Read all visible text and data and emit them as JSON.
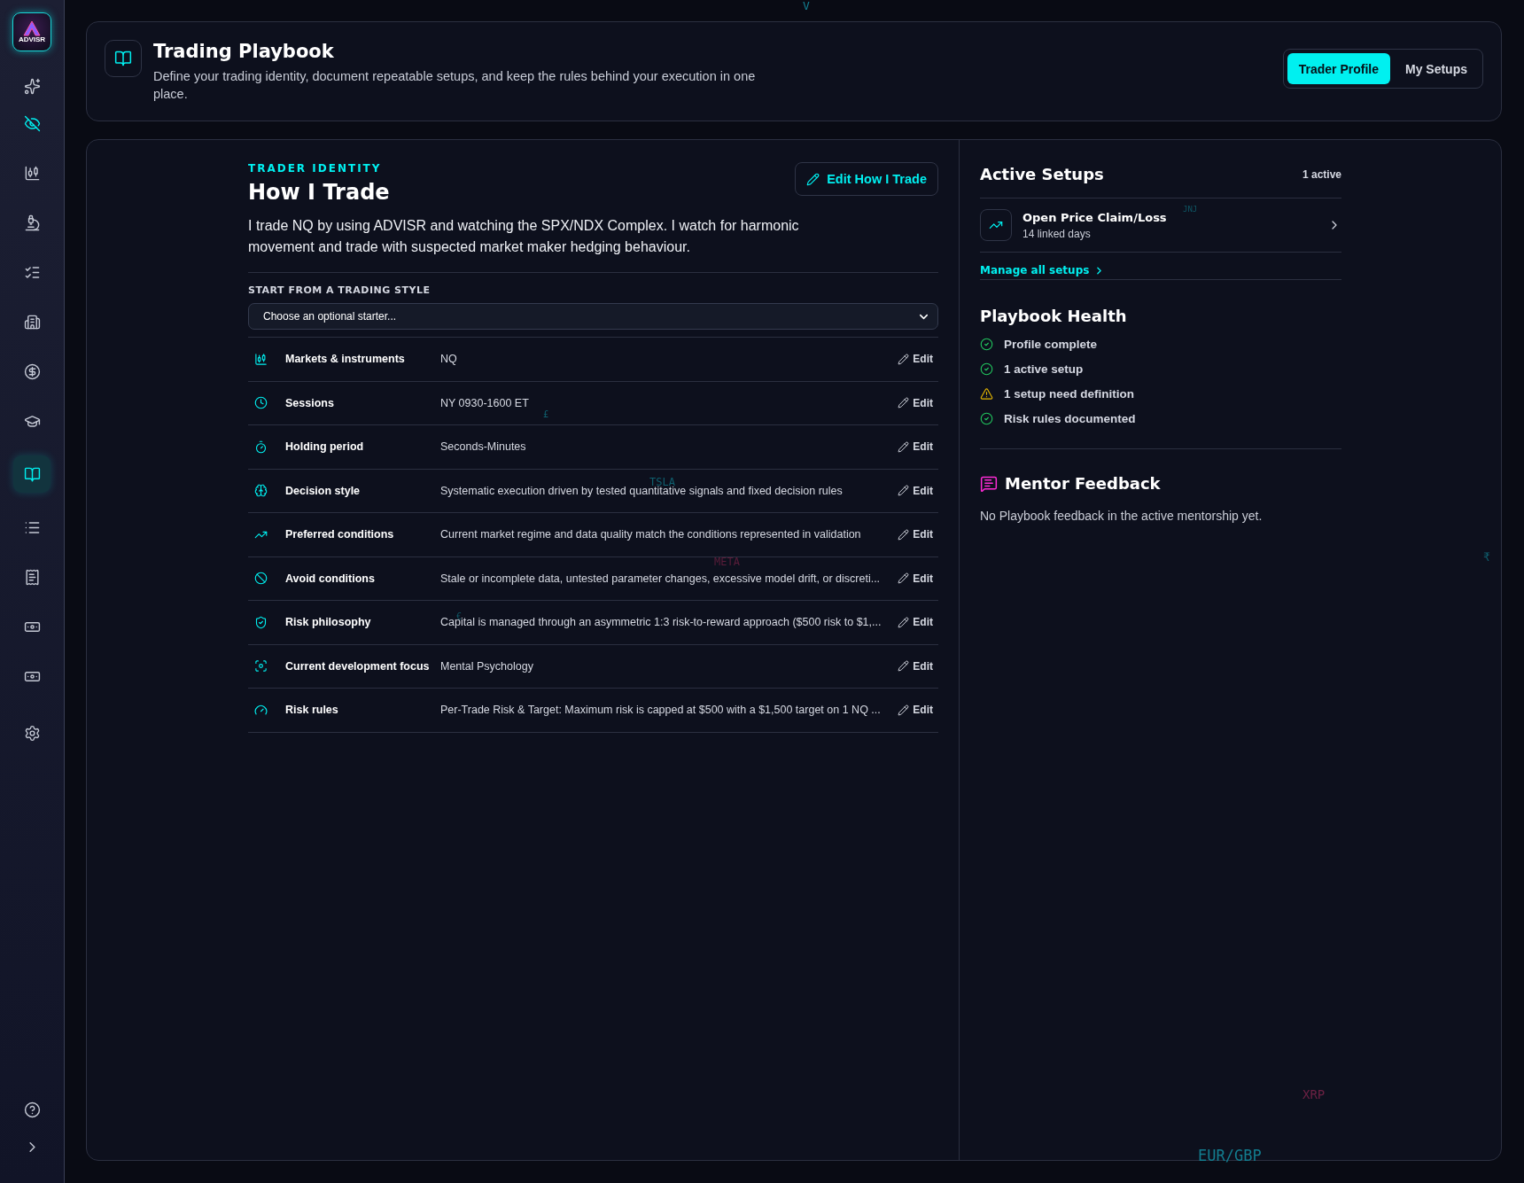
{
  "sidebar": {
    "logo_text": "ADVISR",
    "privacy_toggle": {
      "on": true
    },
    "items": [
      {
        "selected": false
      },
      {
        "selected": false
      },
      {
        "selected": false
      },
      {
        "selected": false
      },
      {
        "selected": false
      },
      {
        "selected": false
      },
      {
        "selected": false
      },
      {
        "selected": true
      },
      {
        "selected": false
      },
      {
        "selected": false
      },
      {
        "selected": false
      },
      {
        "selected": false
      },
      {
        "selected": false
      }
    ]
  },
  "header": {
    "title": "Trading Playbook",
    "subtitle": "Define your trading identity, document repeatable setups, and keep the rules behind your execution in one place.",
    "tabs": [
      {
        "label": "Trader Profile",
        "selected": true
      },
      {
        "label": "My Setups",
        "selected": false
      }
    ]
  },
  "identity": {
    "eyebrow": "TRADER IDENTITY",
    "title": "How I Trade",
    "edit_button": "Edit How I Trade",
    "description": "I trade NQ by using ADVISR and watching the SPX/NDX Complex. I watch for harmonic movement and trade with suspected market maker hedging behaviour.",
    "starter": {
      "label": "START FROM A TRADING STYLE",
      "placeholder": "Choose an optional starter..."
    },
    "rows": [
      {
        "label": "Markets & instruments",
        "value": "NQ",
        "action": "Edit"
      },
      {
        "label": "Sessions",
        "value": "NY 0930-1600 ET",
        "action": "Edit"
      },
      {
        "label": "Holding period",
        "value": "Seconds-Minutes",
        "action": "Edit"
      },
      {
        "label": "Decision style",
        "value": "Systematic execution driven by tested quantitative signals and fixed decision rules",
        "action": "Edit"
      },
      {
        "label": "Preferred conditions",
        "value": "Current market regime and data quality match the conditions represented in validation",
        "action": "Edit"
      },
      {
        "label": "Avoid conditions",
        "value": "Stale or incomplete data, untested parameter changes, excessive model drift, or discreti...",
        "action": "Edit"
      },
      {
        "label": "Risk philosophy",
        "value": "Capital is managed through an asymmetric 1:3 risk-to-reward approach ($500 risk to $1,...",
        "action": "Edit"
      },
      {
        "label": "Current development focus",
        "value": "Mental Psychology",
        "action": "Edit"
      },
      {
        "label": "Risk rules",
        "value": "Per-Trade Risk & Target: Maximum risk is capped at $500 with a $1,500 target on 1 NQ ...",
        "action": "Edit"
      }
    ]
  },
  "active_setups": {
    "title": "Active Setups",
    "count": "1 active",
    "setups": [
      {
        "name": "Open Price Claim/Loss",
        "meta": "14 linked days"
      }
    ],
    "manage_link": "Manage all setups"
  },
  "health": {
    "title": "Playbook Health",
    "items": [
      {
        "kind": "ok",
        "text": "Profile complete"
      },
      {
        "kind": "ok",
        "text": "1 active setup"
      },
      {
        "kind": "warning",
        "text": "1 setup need definition"
      },
      {
        "kind": "ok",
        "text": "Risk rules documented"
      }
    ]
  },
  "mentor": {
    "title": "Mentor Feedback",
    "message": "No Playbook feedback in the active mentorship yet."
  },
  "background_tickers": [
    {
      "text": "V",
      "color": "#137d8f"
    },
    {
      "text": "JNJ",
      "color": "#0f5563"
    },
    {
      "text": "£",
      "color": "#0f5f6e"
    },
    {
      "text": "TSLA",
      "color": "#0f5f6e"
    },
    {
      "text": "META",
      "color": "#5a1d3a"
    },
    {
      "text": "€",
      "color": "#0f5563"
    },
    {
      "text": "₹",
      "color": "#0f5f6e"
    },
    {
      "text": "XRP",
      "color": "#6b2143"
    },
    {
      "text": "EUR/GBP",
      "color": "#137d8f"
    }
  ]
}
